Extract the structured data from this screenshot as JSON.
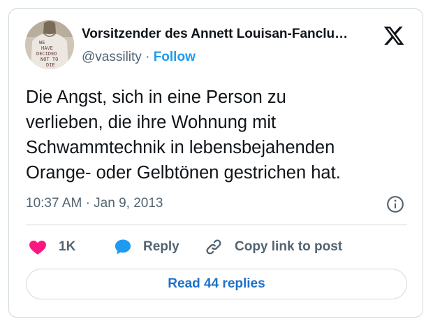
{
  "author": {
    "display_name": "Vorsitzender des Annett Louisan-Fanclu…",
    "handle": "@vassility",
    "separator": "·",
    "follow_label": "Follow",
    "shirt_text": [
      "WE",
      "HAVE",
      "DECIDED",
      "NOT TO",
      "DIE"
    ]
  },
  "tweet": {
    "lines": [
      "Die Angst, sich in eine Person zu",
      "verlieben, die ihre Wohnung mit",
      "Schwammtechnik in lebensbejahenden",
      "Orange- oder Gelbtönen gestrichen hat."
    ],
    "time": "10:37 AM",
    "separator": "·",
    "date": "Jan 9, 2013"
  },
  "actions": {
    "like_count": "1K",
    "reply_label": "Reply",
    "copy_label": "Copy link to post"
  },
  "footer": {
    "read_replies_label": "Read 44 replies"
  },
  "colors": {
    "accent": "#1d9bf0",
    "like": "#f91880",
    "text": "#0f1419",
    "muted": "#536471",
    "border": "#cfd9de"
  },
  "icons": [
    "x-logo-icon",
    "info-icon",
    "heart-icon",
    "reply-bubble-icon",
    "link-icon"
  ]
}
